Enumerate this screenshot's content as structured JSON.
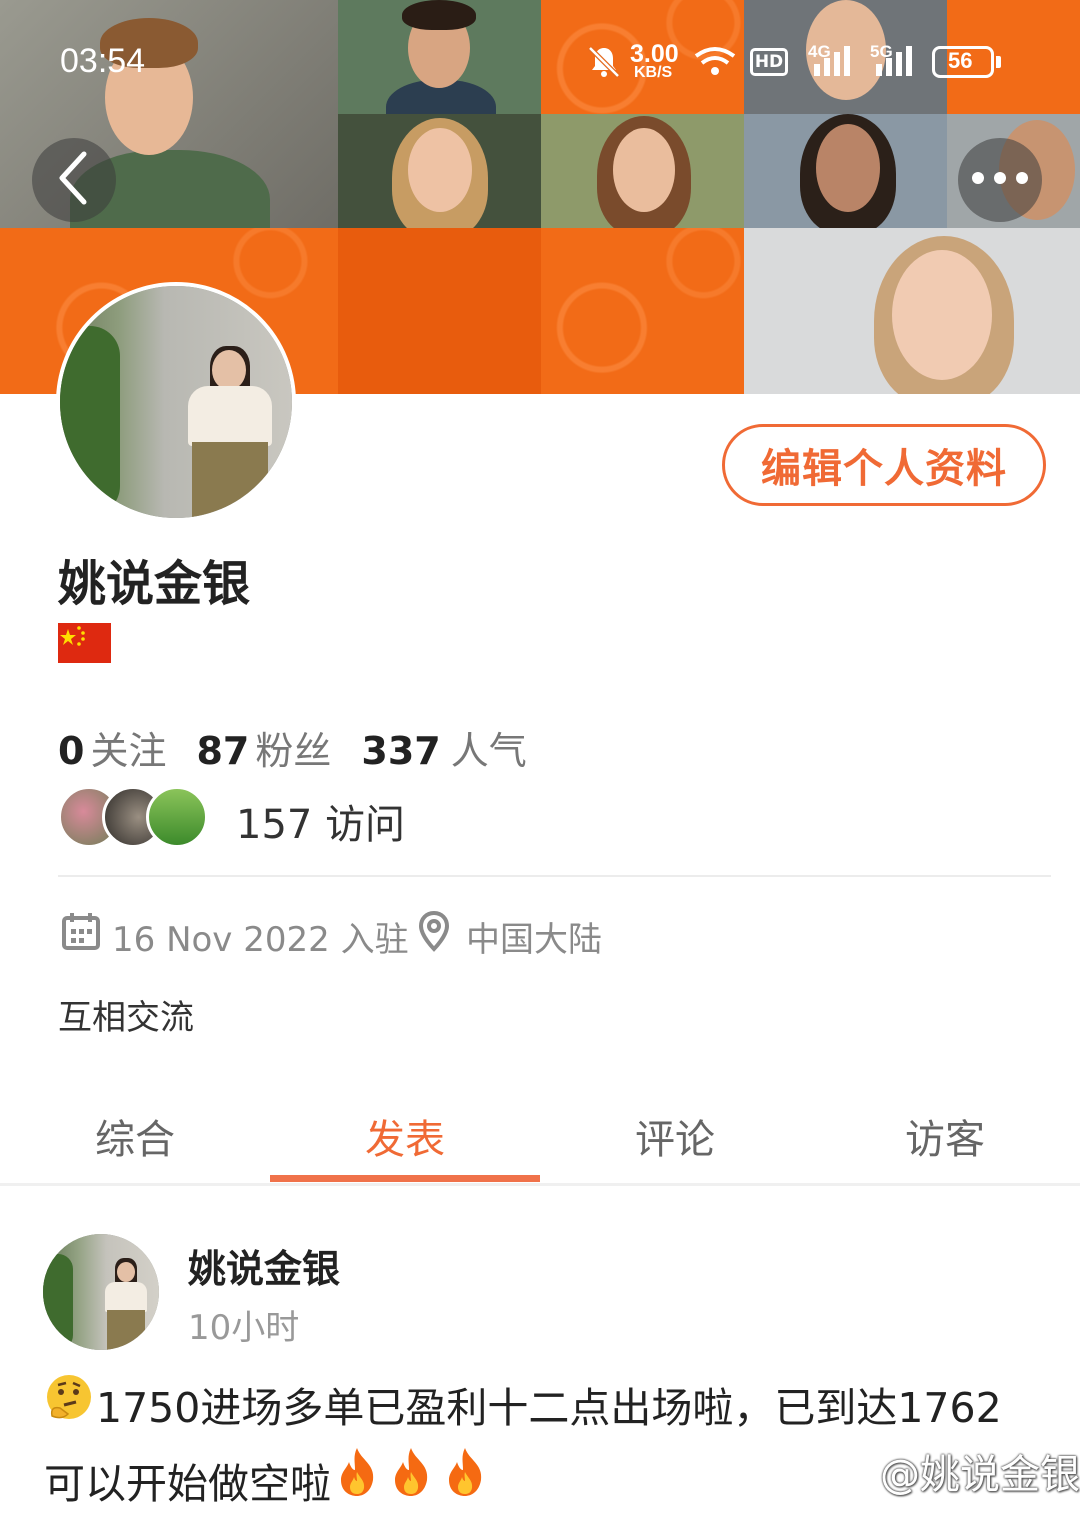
{
  "status_bar": {
    "time": "03:54",
    "net_speed_value": "3.00",
    "net_speed_unit": "KB/S",
    "hd_label": "HD",
    "signal_4g_label": "4G",
    "signal_5g_label": "5G",
    "battery_level": "56"
  },
  "header": {
    "back_icon": "chevron-left-icon",
    "more_icon": "more-dots-icon"
  },
  "profile": {
    "edit_button_label": "编辑个人资料",
    "name": "姚说金银",
    "flag": "china-flag",
    "stats": {
      "following_count": "0",
      "following_label": "关注",
      "followers_count": "87",
      "followers_label": "粉丝",
      "popularity_count": "337",
      "popularity_label": "人气"
    },
    "visits": "157 访问",
    "joined": "16 Nov 2022 入驻",
    "location": "中国大陆",
    "bio": "互相交流"
  },
  "tabs": [
    {
      "label": "综合"
    },
    {
      "label": "发表"
    },
    {
      "label": "评论"
    },
    {
      "label": "访客"
    }
  ],
  "active_tab": "发表",
  "post": {
    "author": "姚说金银",
    "time": "10小时",
    "line1": "1750进场多单已盈利十二点出场啦，已到达1762",
    "line2": "可以开始做空啦",
    "leading_emoji": "thinking-face-icon",
    "trailing_emoji": "fire-icon"
  },
  "watermark": "@姚说金银",
  "colors": {
    "accent": "#f06a35",
    "brand_orange": "#f26b17",
    "flag_red": "#de2910",
    "flag_star": "#ffde00"
  }
}
